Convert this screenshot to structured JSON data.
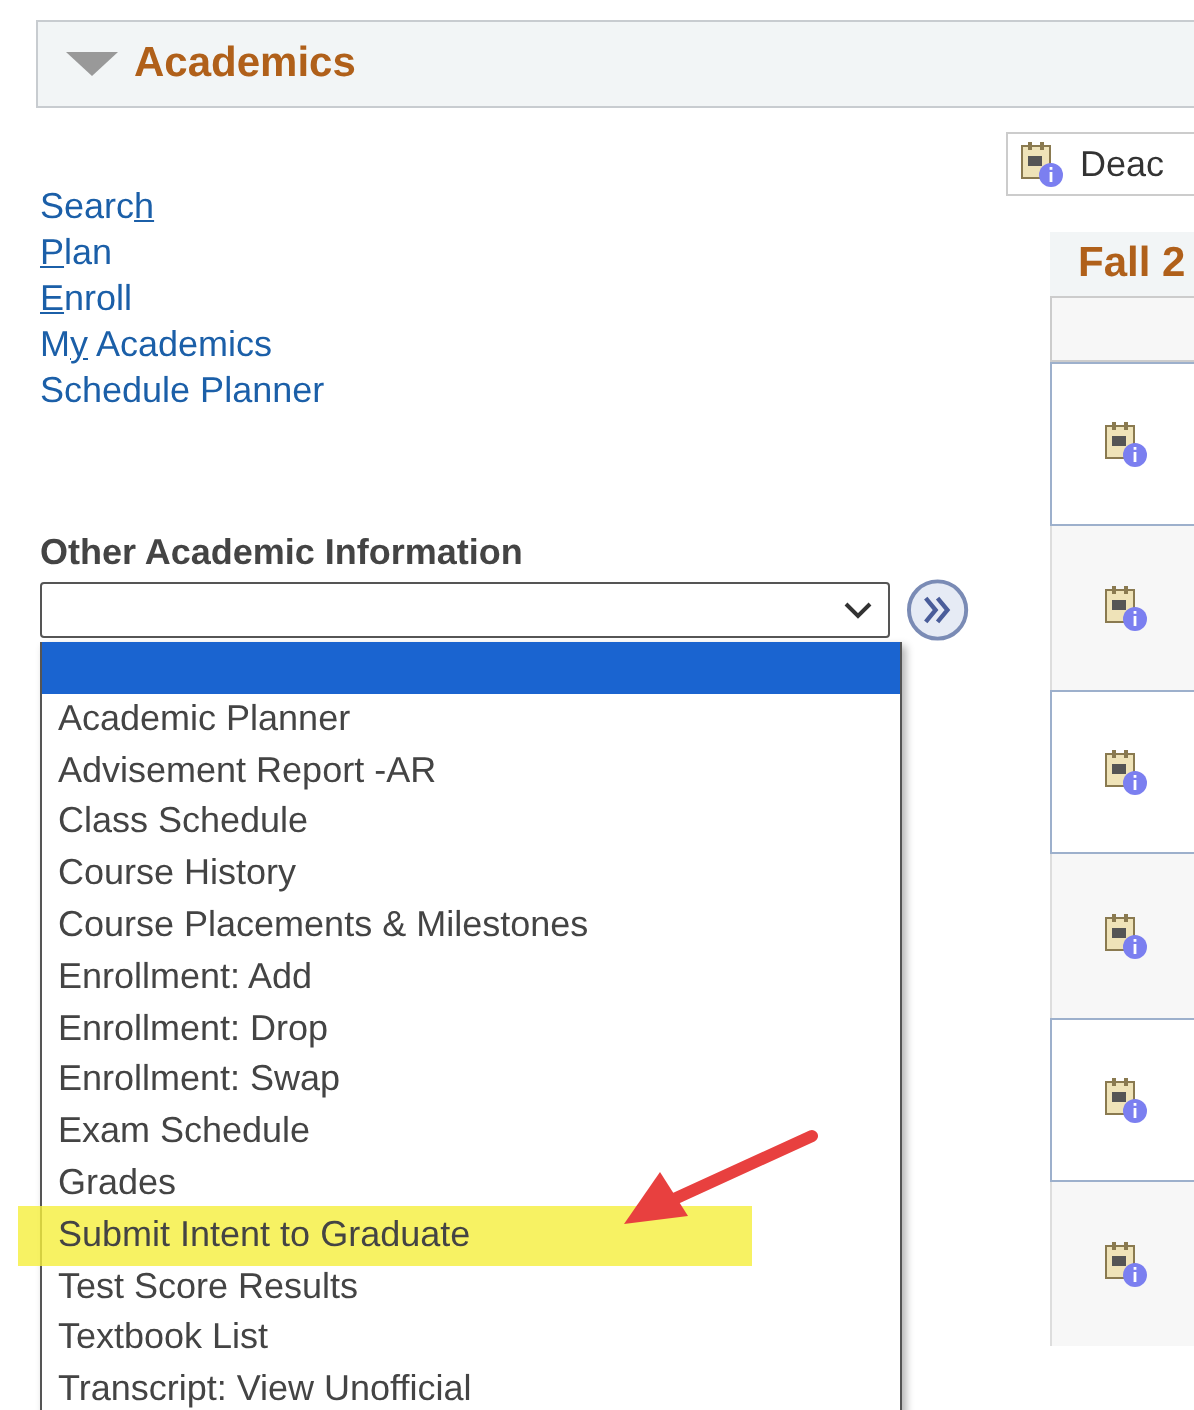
{
  "section": {
    "title": "Academics",
    "expanded": true
  },
  "links": [
    {
      "before": "Searc",
      "access_key": "h"
    },
    {
      "access_key": "P",
      "after": "lan"
    },
    {
      "access_key": "E",
      "after": "nroll"
    },
    {
      "before": "M",
      "access_key": "y",
      "after": " Academics"
    },
    {
      "before": "Schedule Planner"
    }
  ],
  "other_info": {
    "label": "Other Academic Information",
    "options": [
      {
        "selected": true,
        "highlighted": false
      },
      {
        "label": "Academic Planner",
        "selected": false,
        "highlighted": false
      },
      {
        "label": "Advisement Report -AR",
        "selected": false,
        "highlighted": false
      },
      {
        "label": "Class Schedule",
        "selected": false,
        "highlighted": false
      },
      {
        "label": "Course History",
        "selected": false,
        "highlighted": false
      },
      {
        "label": "Course Placements & Milestones",
        "selected": false,
        "highlighted": false
      },
      {
        "label": "Enrollment: Add",
        "selected": false,
        "highlighted": false
      },
      {
        "label": "Enrollment: Drop",
        "selected": false,
        "highlighted": false
      },
      {
        "label": "Enrollment: Swap",
        "selected": false,
        "highlighted": false
      },
      {
        "label": "Exam Schedule",
        "selected": false,
        "highlighted": false
      },
      {
        "label": "Grades",
        "selected": false,
        "highlighted": false
      },
      {
        "label": "Submit Intent to Graduate",
        "selected": false,
        "highlighted": true
      },
      {
        "label": "Test Score Results",
        "selected": false,
        "highlighted": false
      },
      {
        "label": "Textbook List",
        "selected": false,
        "highlighted": false
      },
      {
        "label": "Transcript: View Unofficial",
        "selected": false,
        "highlighted": false
      }
    ]
  },
  "right_panel": {
    "deadlines_button": "Deac",
    "term_title": "Fall 2",
    "rows": [
      {
        "bordered": true
      },
      {
        "bordered": false
      },
      {
        "bordered": true
      },
      {
        "bordered": false
      },
      {
        "bordered": true
      },
      {
        "bordered": false
      }
    ]
  }
}
